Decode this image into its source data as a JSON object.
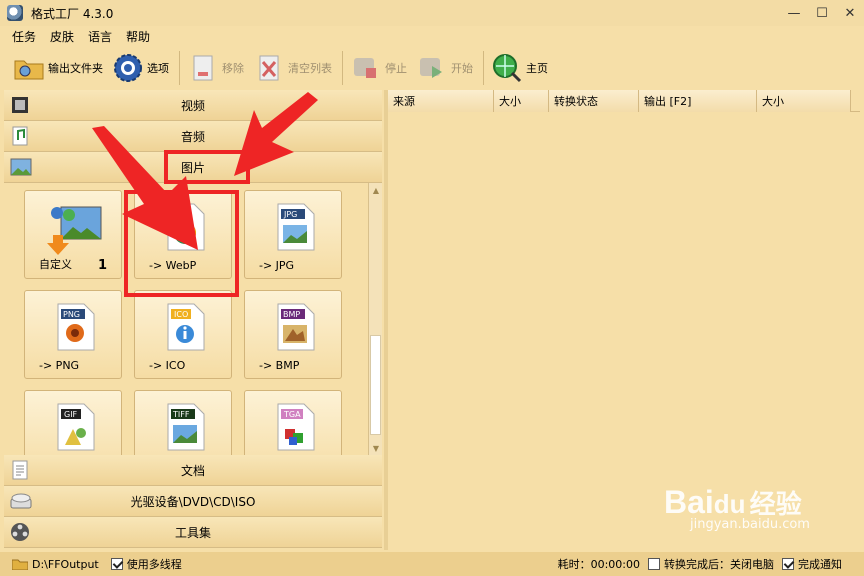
{
  "window": {
    "title": "格式工厂 4.3.0",
    "minimize": "—",
    "maximize": "☐",
    "close": "✕"
  },
  "menu": [
    "任务",
    "皮肤",
    "语言",
    "帮助"
  ],
  "toolbar": {
    "output_folder": "输出文件夹",
    "options": "选项",
    "remove": "移除",
    "clear_list": "清空列表",
    "stop": "停止",
    "start": "开始",
    "home": "主页"
  },
  "categories": {
    "video": "视频",
    "audio": "音频",
    "image": "图片",
    "document": "文档",
    "optical": "光驱设备\\DVD\\CD\\ISO",
    "tools": "工具集"
  },
  "tiles": [
    {
      "label": "自定义",
      "count": "1"
    },
    {
      "label": "-> WebP",
      "badge": "WebP"
    },
    {
      "label": "-> JPG",
      "badge": "JPG"
    },
    {
      "label": "-> PNG",
      "badge": "PNG"
    },
    {
      "label": "-> ICO",
      "badge": "ICO"
    },
    {
      "label": "-> BMP",
      "badge": "BMP"
    },
    {
      "label": "",
      "badge": "GIF"
    },
    {
      "label": "",
      "badge": "TIFF"
    },
    {
      "label": "",
      "badge": "TGA"
    }
  ],
  "columns": [
    "来源",
    "大小",
    "转换状态",
    "输出 [F2]",
    "大小"
  ],
  "status": {
    "output_path": "D:\\FFOutput",
    "multithread": "使用多线程",
    "elapsed": "耗时：00:00:00",
    "after_done": "转换完成后：关闭电脑",
    "notify": "完成通知"
  },
  "watermark": {
    "brand": "Bai",
    "brand_mark": "du",
    "brand_cn": "经验",
    "url": "jingyan.baidu.com"
  },
  "colors": {
    "annotation": "#ee2525",
    "background": "#f6dfa8"
  }
}
